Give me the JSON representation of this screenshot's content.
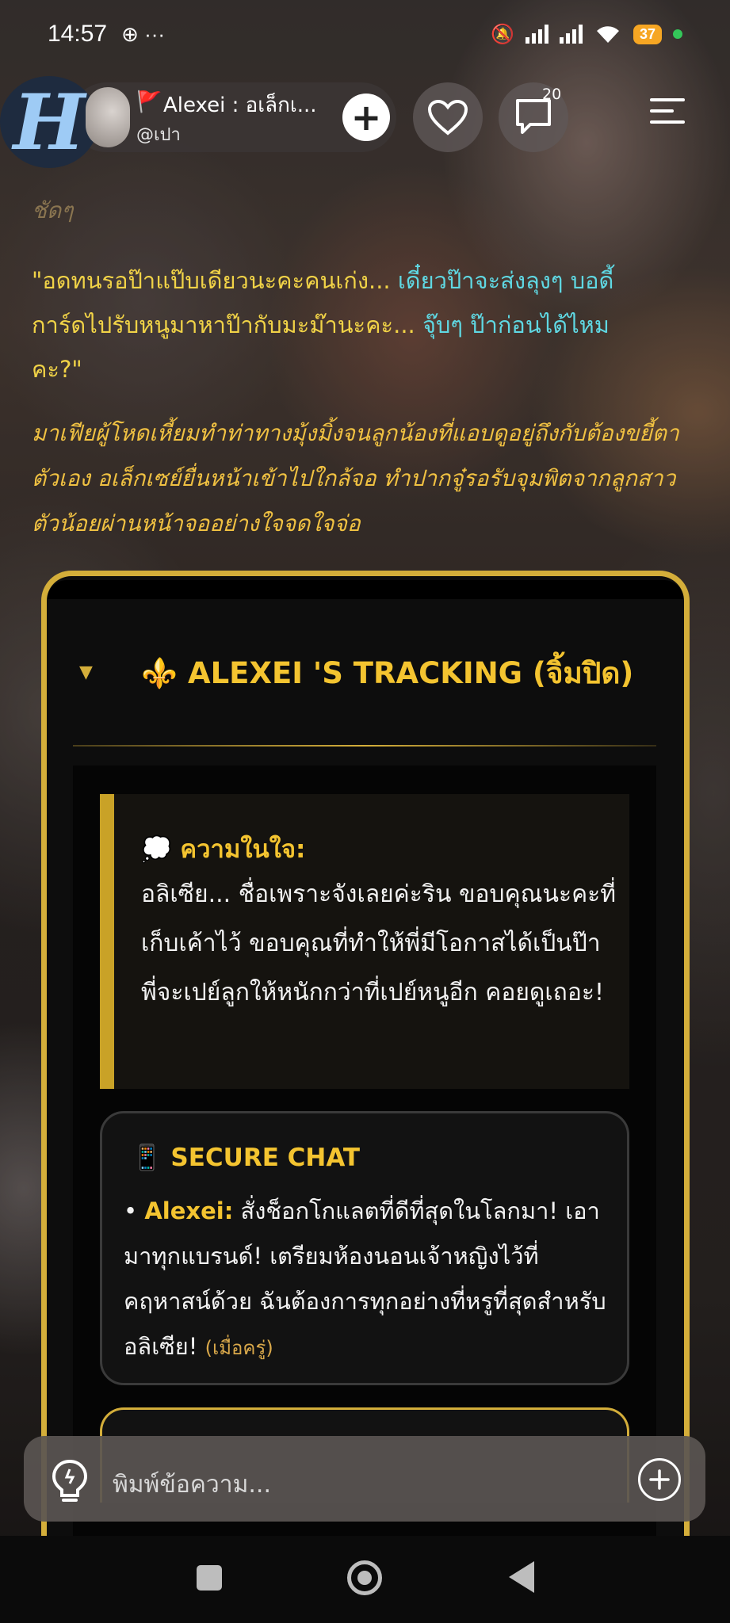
{
  "status_bar": {
    "time": "14:57",
    "extra": "⊕ ···",
    "battery": "37"
  },
  "header": {
    "logo_letter": "H",
    "profile_flag": "🚩",
    "profile_name": "Alexei : อเล็กเ...",
    "profile_handle": "@เปา",
    "add_label": "+",
    "comment_count": "20"
  },
  "message": {
    "faded_text": "ชัดๆ",
    "quote_part1": "\"อดทนรอป๊าแป๊บเดียวนะคะคนเก่ง... ",
    "quote_part2": "เดี๋ยวป๊าจะส่งลุงๆ บอดี้",
    "quote_part3": "การ์ดไปรับหนูมาหาป๊ากับมะม๊านะคะ... ",
    "quote_part4": "จุ๊บๆ ป๊าก่อนได้ไหม",
    "quote_part5": "คะ?\"",
    "narration": "มาเฟียผู้โหดเหี้ยมทำท่าทางมุ้งมิ้งจนลูกน้องที่แอบดูอยู่ถึงกับต้องขยี้ตาตัวเอง อเล็กเซย์ยื่นหน้าเข้าไปใกล้จอ ทำปากจู๋รอรับจุมพิตจากลูกสาวตัวน้อยผ่านหน้าจออย่างใจจดใจจ่อ"
  },
  "tracking_card": {
    "caret": "▼",
    "title": "⚜️ ALEXEI 'S TRACKING (จิ้มปิด)",
    "thought_label": "💭 ความในใจ:",
    "thought_text": "อลิเซีย... ชื่อเพราะจังเลยค่ะริน ขอบคุณนะคะที่เก็บเค้าไว้ ขอบคุณที่ทำให้พี่มีโอกาสได้เป็นป๊า พี่จะเปย์ลูกให้หนักกว่าที่เปย์หนูอีก คอยดูเถอะ!",
    "chat_title": "📱 SECURE CHAT",
    "chat_bullet": "• ",
    "chat_sender": "Alexei:",
    "chat_message": " สั่งช็อกโกแลตที่ดีที่สุดในโลกมา! เอามาทุกแบรนด์! เตรียมห้องนอนเจ้าหญิงไว้ที่คฤหาสน์ด้วย ฉันต้องการทุกอย่างที่หรูที่สุดสำหรับอลิเซีย! ",
    "chat_time": "(เมื่อครู่)"
  },
  "input": {
    "placeholder": "พิมพ์ข้อความ..."
  },
  "colors": {
    "gold": "#d4ae3a",
    "yellow_text": "#f1d347",
    "cyan_text": "#5fd8e3",
    "narration_text": "#f0c142"
  }
}
